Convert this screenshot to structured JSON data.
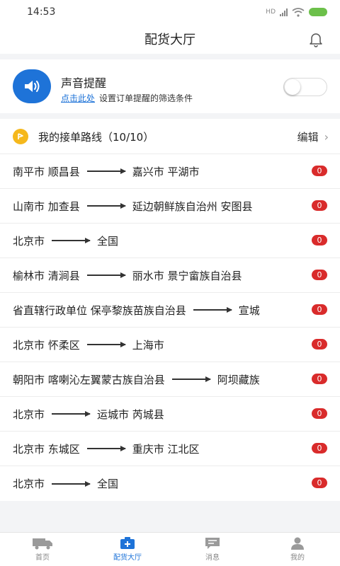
{
  "status": {
    "time": "14:53",
    "network": "HD"
  },
  "header": {
    "title": "配货大厅"
  },
  "sound": {
    "title": "声音提醒",
    "link": "点击此处",
    "desc": "设置订单提醒的筛选条件",
    "enabled": false
  },
  "routes": {
    "title": "我的接单路线（10/10）",
    "edit_label": "编辑",
    "items": [
      {
        "from": "南平市 顺昌县",
        "to": "嘉兴市 平湖市",
        "count": "0"
      },
      {
        "from": "山南市 加查县",
        "to": "延边朝鲜族自治州 安图县",
        "count": "0"
      },
      {
        "from": "北京市",
        "to": "全国",
        "count": "0"
      },
      {
        "from": "榆林市 清涧县",
        "to": "丽水市 景宁畲族自治县",
        "count": "0"
      },
      {
        "from": "省直辖行政单位 保亭黎族苗族自治县",
        "to": "宣城",
        "count": "0"
      },
      {
        "from": "北京市 怀柔区",
        "to": "上海市",
        "count": "0"
      },
      {
        "from": "朝阳市 喀喇沁左翼蒙古族自治县",
        "to": "阿坝藏族",
        "count": "0"
      },
      {
        "from": "北京市",
        "to": "运城市 芮城县",
        "count": "0"
      },
      {
        "from": "北京市 东城区",
        "to": "重庆市 江北区",
        "count": "0"
      },
      {
        "from": "北京市",
        "to": "全国",
        "count": "0"
      }
    ]
  },
  "tabs": [
    {
      "label": "首页",
      "icon": "truck-icon",
      "active": false
    },
    {
      "label": "配货大厅",
      "icon": "cargo-hall-icon",
      "active": true
    },
    {
      "label": "消息",
      "icon": "message-icon",
      "active": false
    },
    {
      "label": "我的",
      "icon": "user-icon",
      "active": false
    }
  ],
  "colors": {
    "accent": "#1e73d8",
    "badge": "#d92b2b",
    "route_icon": "#f5b81c"
  }
}
